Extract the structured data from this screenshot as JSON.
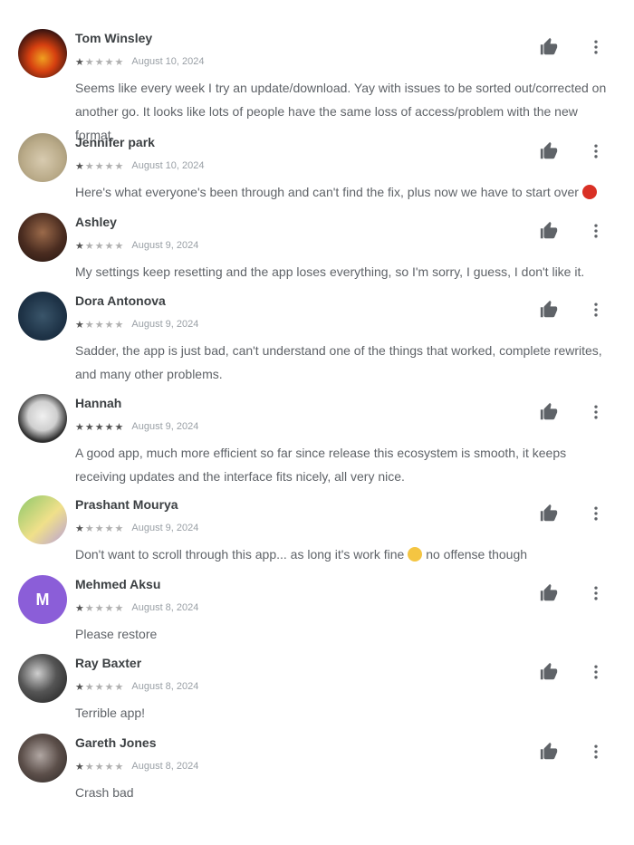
{
  "reviews": [
    {
      "author": "Tom Winsley",
      "avatar_initial": "",
      "stars_filled": 1,
      "date": "August 10, 2024",
      "text": "Seems like every week I try an update/download. Yay with issues to be sorted out/corrected on another go. It looks like lots of people have the same loss of access/problem with the new format."
    },
    {
      "author": "Jennifer park",
      "avatar_initial": "",
      "stars_filled": 1,
      "date": "August 10, 2024",
      "text": "Here's what everyone's been through and can't find the fix, plus now we have to start over",
      "emoji": "red"
    },
    {
      "author": "Ashley",
      "avatar_initial": "",
      "stars_filled": 1,
      "date": "August 9, 2024",
      "text": "My settings keep resetting and the app loses everything, so I'm sorry, I guess, I don't like it."
    },
    {
      "author": "Dora Antonova",
      "avatar_initial": "",
      "stars_filled": 1,
      "date": "August 9, 2024",
      "text": "Sadder, the app is just bad, can't understand one of the things that worked, complete rewrites, and many other problems."
    },
    {
      "author": "Hannah",
      "avatar_initial": "",
      "stars_filled": 5,
      "date": "August 9, 2024",
      "text": "A good app, much more efficient so far since release this ecosystem is smooth, it keeps receiving updates and the interface fits nicely, all very nice."
    },
    {
      "author": "Prashant Mourya",
      "avatar_initial": "",
      "stars_filled": 1,
      "date": "August 9, 2024",
      "text": "Don't want to scroll through this app... as long it's work fine",
      "emoji": "yellow",
      "text_suffix": "no offense though"
    },
    {
      "author": "Mehmed Aksu",
      "avatar_initial": "M",
      "stars_filled": 1,
      "date": "August 8, 2024",
      "text": "Please restore"
    },
    {
      "author": "Ray Baxter",
      "avatar_initial": "",
      "stars_filled": 1,
      "date": "August 8, 2024",
      "text": "Terrible app!"
    },
    {
      "author": "Gareth Jones",
      "avatar_initial": "",
      "stars_filled": 1,
      "date": "August 8, 2024",
      "text": "Crash bad"
    }
  ],
  "icons": {
    "helpful": "thumbs-up-icon",
    "more": "more-vert-icon"
  }
}
